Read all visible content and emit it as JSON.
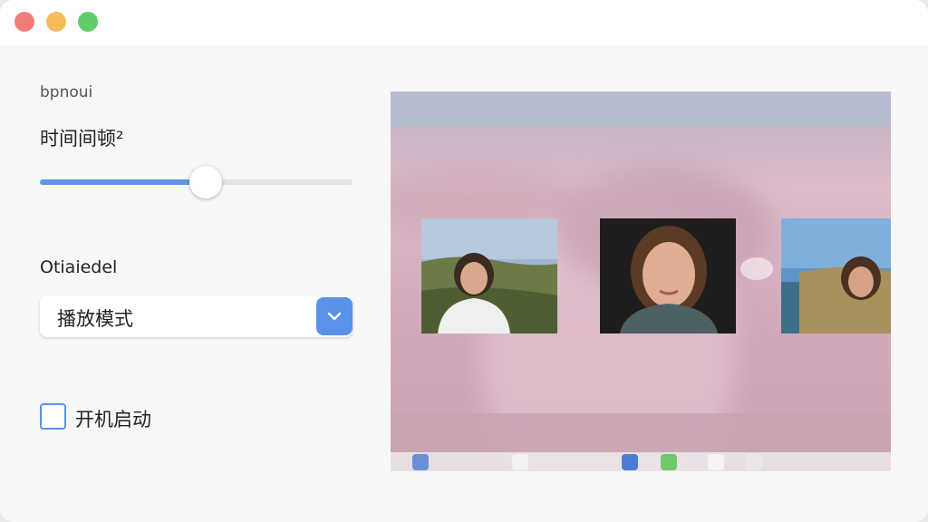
{
  "settings": {
    "section_label": "bpnoui",
    "interval_label": "时间间顿²",
    "slider_value": 0.53,
    "mode_label": "Otiaiedel",
    "mode_value": "播放模式",
    "startup_label": "开机启动",
    "startup_checked": false
  },
  "colors": {
    "accent": "#5a92ea",
    "close": "#f07d7a",
    "minimize": "#f5bd59",
    "maximize": "#5fcd6a"
  },
  "icons": {
    "dropdown": "chevron-down-icon"
  }
}
